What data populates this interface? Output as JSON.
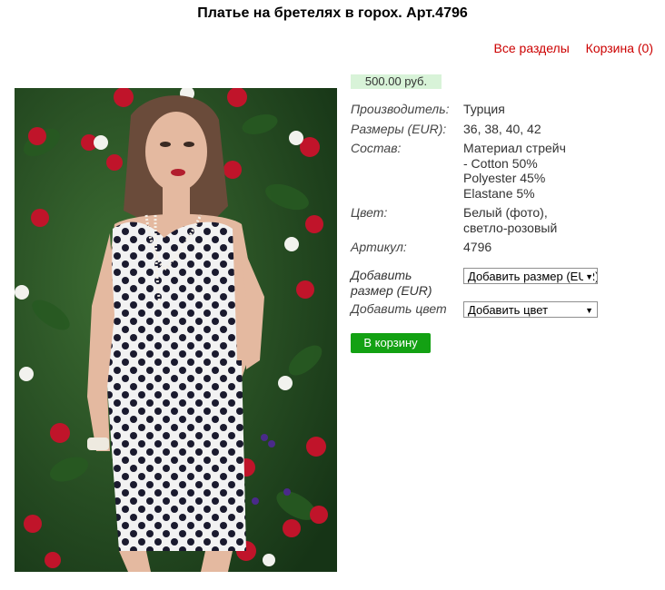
{
  "product": {
    "title": "Платье на бретелях в горох. Арт.4796",
    "price": "500.00 руб.",
    "specs": [
      {
        "label": "Производитель:",
        "value": "Турция"
      },
      {
        "label": "Размеры (EUR):",
        "value": "36, 38, 40, 42"
      },
      {
        "label": "Состав:",
        "value": "Материал стрейч\n- Cotton 50%\nPolyester 45%\nElastane 5%"
      },
      {
        "label": "Цвет:",
        "value": "Белый (фото),\nсветло-розовый"
      },
      {
        "label": "Артикул:",
        "value": "4796"
      }
    ]
  },
  "nav": {
    "all_sections": "Все разделы",
    "cart": "Корзина (0)"
  },
  "options": {
    "size_label": "Добавить\nразмер (EUR)",
    "size_selected": "Добавить размер (EUR)",
    "color_label": "Добавить цвет",
    "color_selected": "Добавить цвет"
  },
  "actions": {
    "add_to_cart": "В корзину"
  },
  "colors": {
    "link": "#cc0000",
    "price_bg": "#d8f3d8",
    "button": "#13a113"
  }
}
